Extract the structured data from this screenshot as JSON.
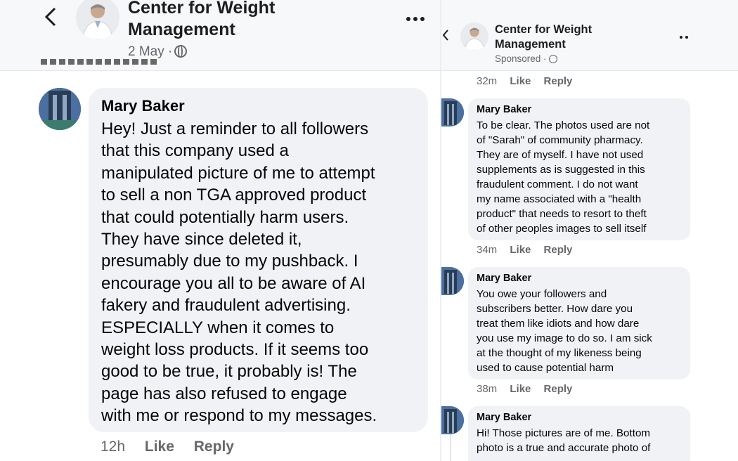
{
  "left": {
    "header": {
      "page_name_line1": "Center for Weight",
      "page_name_line2": "Management",
      "date": "2 May ·",
      "back_icon": "chevron-left-icon",
      "more_icon": "more-horizontal-icon",
      "globe_icon": "globe-icon"
    },
    "comment": {
      "author": "Mary Baker",
      "lines": [
        "Hey! Just a reminder to all followers",
        "that this company used a",
        "manipulated picture of me to attempt",
        "to sell a non TGA approved product",
        "that could potentially harm users.",
        "They have since deleted it,",
        "presumably due to my pushback. I",
        "encourage you all to be aware of AI",
        "fakery and fraudulent advertising.",
        "ESPECIALLY when it comes to",
        "weight loss products. If it seems too",
        "good to be true, it probably is! The",
        "page has also refused to engage",
        "with me or respond to my messages."
      ],
      "time": "12h",
      "like": "Like",
      "reply": "Reply"
    }
  },
  "right": {
    "header": {
      "page_name_line1": "Center for Weight",
      "page_name_line2": "Management",
      "sponsored": "Sponsored ·",
      "back_icon": "chevron-left-icon",
      "more_icon": "more-horizontal-icon"
    },
    "top_meta": {
      "time": "32m",
      "like": "Like",
      "reply": "Reply"
    },
    "comments": [
      {
        "author": "Mary Baker",
        "lines": [
          "To be clear. The photos used are not",
          "of \"Sarah\" of community pharmacy.",
          "They are of myself. I have not used",
          "supplements as is suggested in this",
          "fraudulent comment. I do not want",
          "my name associated with a \"health",
          "product\" that needs to resort to theft",
          "of other peoples images to sell itself"
        ],
        "time": "34m",
        "like": "Like",
        "reply": "Reply"
      },
      {
        "author": "Mary Baker",
        "lines": [
          "You owe your followers and",
          "subscribers better. How dare you",
          "treat them like idiots and how dare",
          "you use my image to do so. I am sick",
          "at the thought of my likeness being",
          "used to cause potential harm"
        ],
        "time": "38m",
        "like": "Like",
        "reply": "Reply"
      },
      {
        "author": "Mary Baker",
        "lines": [
          "Hi! Those pictures are of me. Bottom",
          "photo is a true and accurate photo of"
        ]
      }
    ]
  }
}
